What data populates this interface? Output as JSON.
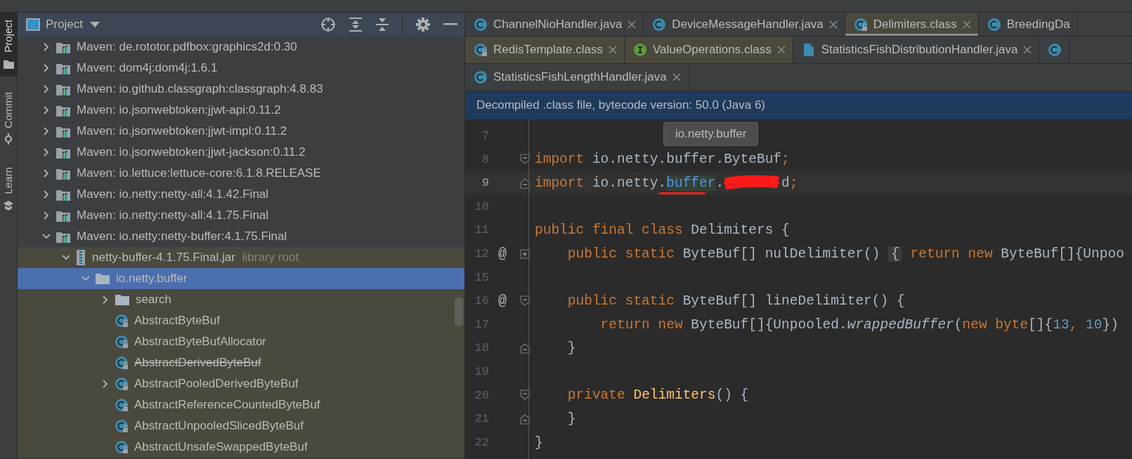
{
  "side_tabs": [
    {
      "label": "Project",
      "kind": "folder",
      "selected": true
    },
    {
      "label": "Commit",
      "kind": "commit",
      "selected": false
    },
    {
      "label": "Learn",
      "kind": "learn",
      "selected": false
    }
  ],
  "project_panel": {
    "title": "Project",
    "tree": [
      {
        "label": "Maven: de.rototor.pdfbox:graphics2d:0.30",
        "kind": "library",
        "expandable": true,
        "expanded": false,
        "selected": false,
        "library_scope": false
      },
      {
        "label": "Maven: dom4j:dom4j:1.6.1",
        "kind": "library",
        "expandable": true,
        "expanded": false,
        "selected": false,
        "library_scope": false
      },
      {
        "label": "Maven: io.github.classgraph:classgraph:4.8.83",
        "kind": "library",
        "expandable": true,
        "expanded": false,
        "selected": false,
        "library_scope": false
      },
      {
        "label": "Maven: io.jsonwebtoken:jjwt-api:0.11.2",
        "kind": "library",
        "expandable": true,
        "expanded": false,
        "selected": false,
        "library_scope": false
      },
      {
        "label": "Maven: io.jsonwebtoken:jjwt-impl:0.11.2",
        "kind": "library",
        "expandable": true,
        "expanded": false,
        "selected": false,
        "library_scope": false
      },
      {
        "label": "Maven: io.jsonwebtoken:jjwt-jackson:0.11.2",
        "kind": "library",
        "expandable": true,
        "expanded": false,
        "selected": false,
        "library_scope": false
      },
      {
        "label": "Maven: io.lettuce:lettuce-core:6.1.8.RELEASE",
        "kind": "library",
        "expandable": true,
        "expanded": false,
        "selected": false,
        "library_scope": false
      },
      {
        "label": "Maven: io.netty:netty-all:4.1.42.Final",
        "kind": "library",
        "expandable": true,
        "expanded": false,
        "selected": false,
        "library_scope": false
      },
      {
        "label": "Maven: io.netty:netty-all:4.1.75.Final",
        "kind": "library",
        "expandable": true,
        "expanded": false,
        "selected": false,
        "library_scope": false
      },
      {
        "label": "Maven: io.netty:netty-buffer:4.1.75.Final",
        "kind": "library",
        "expandable": true,
        "expanded": true,
        "selected": false,
        "library_scope": false,
        "children": [
          {
            "label": "netty-buffer-4.1.75.Final.jar",
            "hint": "library root",
            "kind": "jar",
            "expandable": true,
            "expanded": true,
            "selected": false,
            "library_scope": true,
            "children": [
              {
                "label": "io.netty.buffer",
                "kind": "package",
                "expandable": true,
                "expanded": true,
                "selected": true,
                "children": [
                  {
                    "label": "search",
                    "kind": "package",
                    "expandable": true,
                    "expanded": false,
                    "selected": false,
                    "library_scope": true
                  },
                  {
                    "label": "AbstractByteBuf",
                    "kind": "class",
                    "expandable": false,
                    "selected": false,
                    "library_scope": true,
                    "deprecated": false
                  },
                  {
                    "label": "AbstractByteBufAllocator",
                    "kind": "class",
                    "expandable": false,
                    "selected": false,
                    "library_scope": true,
                    "deprecated": false
                  },
                  {
                    "label": "AbstractDerivedByteBuf",
                    "kind": "class",
                    "expandable": false,
                    "selected": false,
                    "library_scope": true,
                    "deprecated": true
                  },
                  {
                    "label": "AbstractPooledDerivedByteBuf",
                    "kind": "class",
                    "expandable": true,
                    "expanded": false,
                    "selected": false,
                    "library_scope": true,
                    "deprecated": false
                  },
                  {
                    "label": "AbstractReferenceCountedByteBuf",
                    "kind": "class",
                    "expandable": false,
                    "selected": false,
                    "library_scope": true,
                    "deprecated": false
                  },
                  {
                    "label": "AbstractUnpooledSlicedByteBuf",
                    "kind": "class",
                    "expandable": false,
                    "selected": false,
                    "library_scope": true,
                    "deprecated": false
                  },
                  {
                    "label": "AbstractUnsafeSwappedByteBuf",
                    "kind": "class",
                    "expandable": false,
                    "selected": false,
                    "library_scope": true,
                    "deprecated": false
                  }
                ]
              }
            ]
          }
        ]
      }
    ]
  },
  "editor_tab_rows": [
    [
      {
        "label": "ChannelNioHandler.java",
        "kind": "class",
        "selected": false,
        "library": false,
        "closable": true
      },
      {
        "label": "DeviceMessageHandler.java",
        "kind": "class",
        "selected": false,
        "library": false,
        "closable": true
      },
      {
        "label": "Delimiters.class",
        "kind": "class_locked",
        "selected": true,
        "library": true,
        "closable": true
      },
      {
        "label": "BreedingDa",
        "kind": "class",
        "selected": false,
        "library": false,
        "closable": false
      }
    ],
    [
      {
        "label": "RedisTemplate.class",
        "kind": "class_locked",
        "selected": false,
        "library": true,
        "closable": true
      },
      {
        "label": "ValueOperations.class",
        "kind": "interface",
        "selected": false,
        "library": true,
        "closable": true
      },
      {
        "label": "StatisticsFishDistributionHandler.java",
        "kind": "java_file",
        "selected": false,
        "library": false,
        "closable": true
      },
      {
        "kind": "class",
        "selected": false,
        "library": false,
        "closable": false
      }
    ],
    [
      {
        "label": "StatisticsFishLengthHandler.java",
        "kind": "class",
        "selected": false,
        "library": false,
        "closable": true
      }
    ]
  ],
  "banner": "Decompiled .class file, bytecode version: 50.0 (Java 6)",
  "tooltip": "io.netty.buffer",
  "code_lines": [
    {
      "number": "7",
      "current": false,
      "fold_start": false,
      "fold_end": false,
      "folded": false
    },
    {
      "number": "8",
      "current": false,
      "fold_start": true,
      "fold_end": false,
      "folded": false,
      "tokens": [
        {
          "kind": "keyword",
          "text": "import"
        },
        {
          "kind": "plain",
          "text": " io.netty.buffer.ByteBuf"
        },
        {
          "kind": "keyword",
          "text": ";"
        }
      ]
    },
    {
      "number": "9",
      "current": true,
      "fold_start": false,
      "fold_end": true,
      "folded": false,
      "tokens": [
        {
          "kind": "keyword",
          "text": "import"
        },
        {
          "kind": "plain",
          "text": " io.netty."
        },
        {
          "kind": "ref",
          "text": "buffer"
        },
        {
          "kind": "plain",
          "text": "."
        },
        {
          "kind": "redaction"
        },
        {
          "kind": "plain",
          "text": "d"
        },
        {
          "kind": "keyword",
          "text": ";"
        }
      ]
    },
    {
      "number": "10",
      "current": false,
      "fold_start": false,
      "fold_end": false,
      "folded": false
    },
    {
      "number": "11",
      "current": false,
      "fold_start": false,
      "fold_end": false,
      "folded": false,
      "tokens": [
        {
          "kind": "keyword",
          "text": "public final class "
        },
        {
          "kind": "plain",
          "text": "Delimiters {"
        }
      ]
    },
    {
      "number": "12",
      "marker": "@",
      "current": false,
      "fold_start": false,
      "fold_end": false,
      "folded": true,
      "tokens": [
        {
          "kind": "keyword",
          "text": "    public static "
        },
        {
          "kind": "plain",
          "text": "ByteBuf[] nulDelimiter() "
        },
        {
          "kind": "folded",
          "text": "{"
        },
        {
          "kind": "keyword",
          "text": " return new "
        },
        {
          "kind": "plain",
          "text": "ByteBuf[]{Unpoo"
        }
      ]
    },
    {
      "number": "15",
      "current": false,
      "fold_start": false,
      "fold_end": false,
      "folded": false
    },
    {
      "number": "16",
      "marker": "@",
      "current": false,
      "fold_start": true,
      "fold_end": false,
      "folded": false,
      "tokens": [
        {
          "kind": "keyword",
          "text": "    public static "
        },
        {
          "kind": "plain",
          "text": "ByteBuf[] lineDelimiter() {"
        }
      ]
    },
    {
      "number": "17",
      "current": false,
      "fold_start": false,
      "fold_end": false,
      "folded": false,
      "tokens": [
        {
          "kind": "keyword",
          "text": "        return new "
        },
        {
          "kind": "plain",
          "text": "ByteBuf[]{Unpooled."
        },
        {
          "kind": "italic",
          "text": "wrappedBuffer"
        },
        {
          "kind": "plain",
          "text": "("
        },
        {
          "kind": "keyword",
          "text": "new byte"
        },
        {
          "kind": "plain",
          "text": "[]{"
        },
        {
          "kind": "number",
          "text": "13"
        },
        {
          "kind": "keyword",
          "text": ", "
        },
        {
          "kind": "number",
          "text": "10"
        },
        {
          "kind": "plain",
          "text": "})"
        }
      ]
    },
    {
      "number": "18",
      "current": false,
      "fold_start": false,
      "fold_end": true,
      "folded": false,
      "tokens": [
        {
          "kind": "plain",
          "text": "    }"
        }
      ]
    },
    {
      "number": "19",
      "current": false,
      "fold_start": false,
      "fold_end": false,
      "folded": false
    },
    {
      "number": "20",
      "current": false,
      "fold_start": true,
      "fold_end": false,
      "folded": false,
      "tokens": [
        {
          "kind": "keyword",
          "text": "    private "
        },
        {
          "kind": "decl",
          "text": "Delimiters"
        },
        {
          "kind": "plain",
          "text": "() {"
        }
      ]
    },
    {
      "number": "21",
      "current": false,
      "fold_start": false,
      "fold_end": true,
      "folded": false,
      "tokens": [
        {
          "kind": "plain",
          "text": "    }"
        }
      ]
    },
    {
      "number": "22",
      "current": false,
      "fold_start": false,
      "fold_end": false,
      "folded": false,
      "tokens": [
        {
          "kind": "plain",
          "text": "}"
        }
      ]
    }
  ]
}
